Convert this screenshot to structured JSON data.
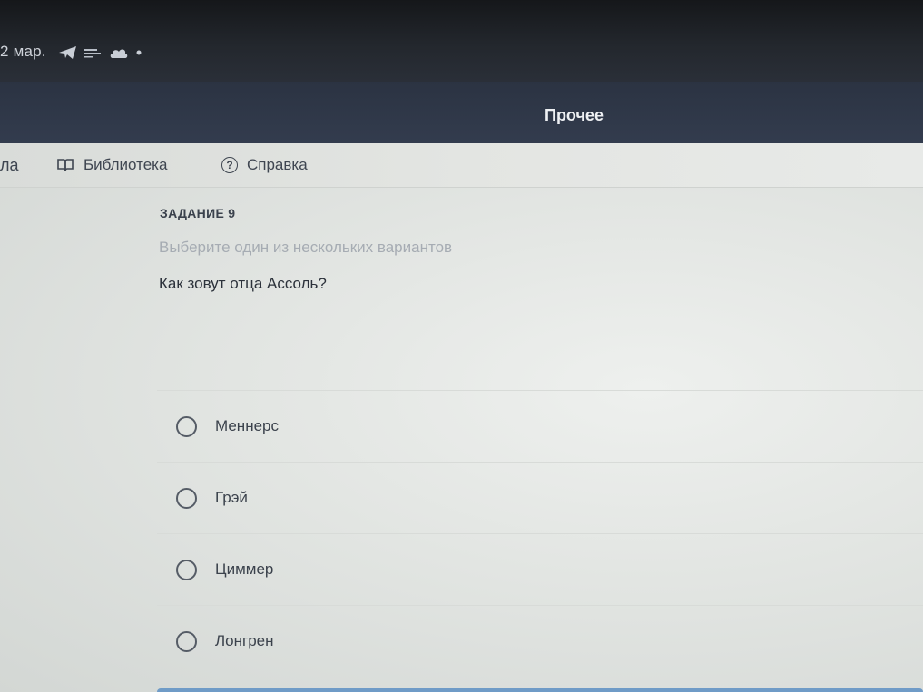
{
  "status_bar": {
    "date": "2 мар.",
    "icons": [
      "telegram-icon",
      "network-icon",
      "cloud-icon",
      "dot-icon"
    ]
  },
  "header": {
    "more_label": "Прочее"
  },
  "subnav": {
    "cut_item": "ла",
    "library_label": "Библиотека",
    "help_label": "Справка"
  },
  "task": {
    "label": "ЗАДАНИЕ 9",
    "hint": "Выберите один из нескольких вариантов",
    "question": "Как зовут отца Ассоль?",
    "options": [
      {
        "label": "Меннерс",
        "selected": false
      },
      {
        "label": "Грэй",
        "selected": false
      },
      {
        "label": "Циммер",
        "selected": false
      },
      {
        "label": "Лонгрен",
        "selected": false
      }
    ]
  },
  "colors": {
    "header_bg": "#2f3748",
    "accent_bottom": "#6f9bc7",
    "text_primary": "#2c323b",
    "text_hint": "#a6acb3"
  }
}
